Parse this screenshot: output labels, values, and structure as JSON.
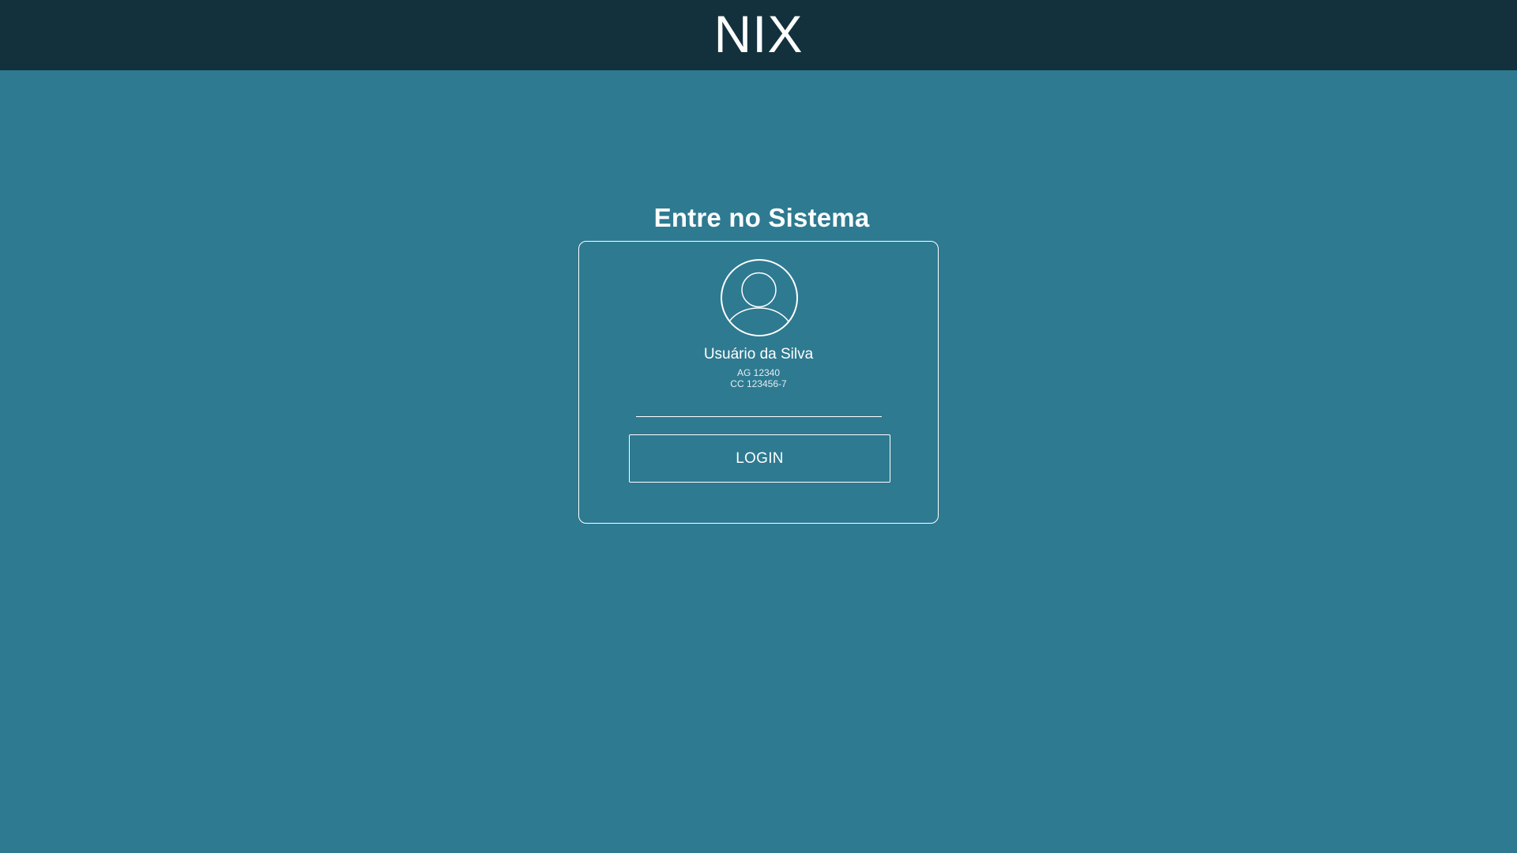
{
  "header": {
    "brand": "NIX"
  },
  "main": {
    "title": "Entre no Sistema"
  },
  "login_card": {
    "avatar_icon": "user-avatar-icon",
    "user_name": "Usuário da Silva",
    "agency": "AG 12340",
    "account": "CC 123456-7",
    "password_value": "",
    "password_placeholder": "",
    "login_label": "LOGIN"
  },
  "colors": {
    "header_bg": "#13313c",
    "page_bg": "#2e7a91",
    "foreground": "#ffffff"
  }
}
